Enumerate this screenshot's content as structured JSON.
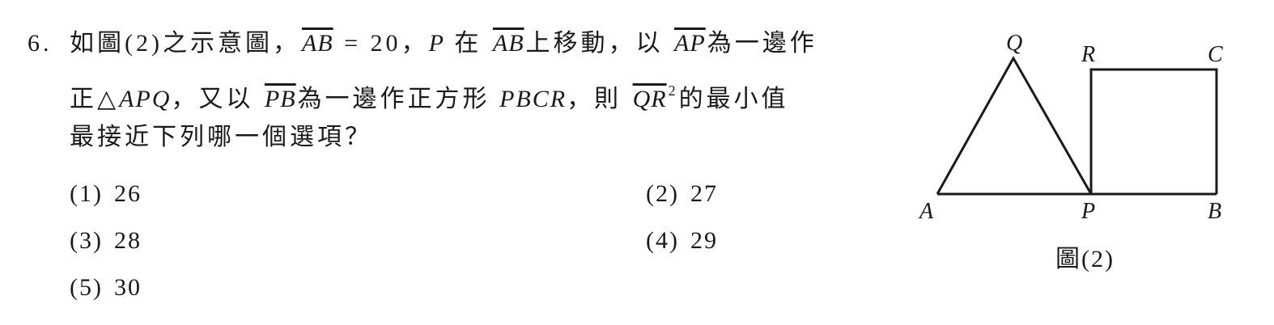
{
  "question": {
    "number": "6.",
    "t1": "如圖(2)之示意圖，",
    "ab1": "AB",
    "t2": " = 20，",
    "p": "P",
    "t3": " 在 ",
    "ab2": "AB",
    "t4": "上移動，以 ",
    "ap": "AP",
    "t5": "為一邊作",
    "t6": "正△",
    "apq": "APQ",
    "t7": "，又以 ",
    "pb": "PB",
    "t8": "為一邊作正方形 ",
    "pbcr": "PBCR",
    "t9": "，則 ",
    "qr": "QR",
    "sq": "2",
    "t10": "的最小值",
    "t11": "最接近下列哪一個選項？"
  },
  "options": [
    {
      "label": "(1)",
      "value": "26"
    },
    {
      "label": "(2)",
      "value": "27"
    },
    {
      "label": "(3)",
      "value": "28"
    },
    {
      "label": "(4)",
      "value": "29"
    },
    {
      "label": "(5)",
      "value": "30"
    }
  ],
  "figure": {
    "points": {
      "A": "A",
      "B": "B",
      "C": "C",
      "P": "P",
      "Q": "Q",
      "R": "R"
    },
    "caption": "圖(2)"
  }
}
